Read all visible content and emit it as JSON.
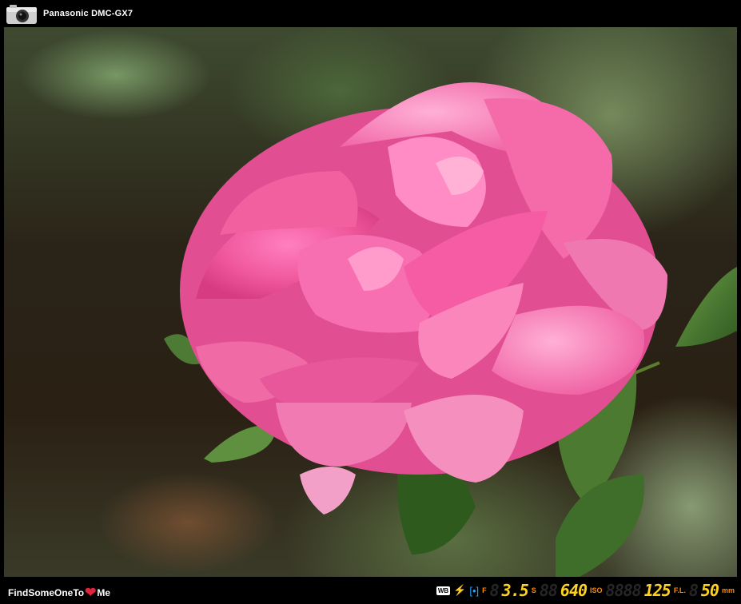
{
  "header": {
    "camera_icon": "camera-icon",
    "camera_model": "Panasonic DMC-GX7"
  },
  "photo": {
    "subject": "pink rose"
  },
  "footer": {
    "brand_left": "FindSomeOneTo",
    "brand_heart": "❤",
    "brand_right": "Me",
    "wb_label": "WB",
    "aperture_label": "F",
    "aperture_value": "3.5",
    "shutter_label": "S",
    "shutter_value": "640",
    "iso_label": "ISO",
    "iso_value": "125",
    "focal_label": "F.L.",
    "focal_value": "50",
    "focal_unit": "mm",
    "colors": {
      "label": "#ff8a00",
      "value": "#ffd21e",
      "meter": "#2aa0ff"
    }
  }
}
